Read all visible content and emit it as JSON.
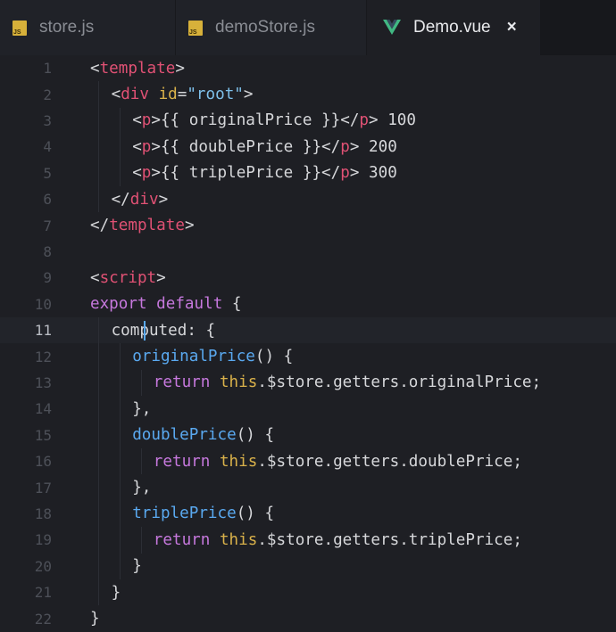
{
  "tabs": [
    {
      "label": "store.js",
      "icon": "js-file-icon",
      "active": false
    },
    {
      "label": "demoStore.js",
      "icon": "js-file-icon",
      "active": false
    },
    {
      "label": "Demo.vue",
      "icon": "vue-file-icon",
      "active": true,
      "close": "×"
    }
  ],
  "js_icon_text": "JS",
  "active_line": 11,
  "colors": {
    "tag": "#e05174",
    "attribute": "#d9b14a",
    "string": "#7ec0ea",
    "keyword": "#c678dd",
    "function": "#5aa9f0",
    "vue_green": "#41b883"
  },
  "lines": [
    {
      "n": "1",
      "indent": 0,
      "tokens": [
        [
          "plain",
          "<"
        ],
        [
          "tag",
          "template"
        ],
        [
          "plain",
          ">"
        ]
      ]
    },
    {
      "n": "2",
      "indent": 1,
      "tokens": [
        [
          "plain",
          "<"
        ],
        [
          "tag",
          "div"
        ],
        [
          "plain",
          " "
        ],
        [
          "attr",
          "id"
        ],
        [
          "plain",
          "="
        ],
        [
          "str",
          "\"root\""
        ],
        [
          "plain",
          ">"
        ]
      ]
    },
    {
      "n": "3",
      "indent": 2,
      "tokens": [
        [
          "plain",
          "<"
        ],
        [
          "tag",
          "p"
        ],
        [
          "plain",
          ">{{ originalPrice }}</"
        ],
        [
          "tag",
          "p"
        ],
        [
          "plain",
          "> 100"
        ]
      ]
    },
    {
      "n": "4",
      "indent": 2,
      "tokens": [
        [
          "plain",
          "<"
        ],
        [
          "tag",
          "p"
        ],
        [
          "plain",
          ">{{ doublePrice }}</"
        ],
        [
          "tag",
          "p"
        ],
        [
          "plain",
          "> 200"
        ]
      ]
    },
    {
      "n": "5",
      "indent": 2,
      "tokens": [
        [
          "plain",
          "<"
        ],
        [
          "tag",
          "p"
        ],
        [
          "plain",
          ">{{ triplePrice }}</"
        ],
        [
          "tag",
          "p"
        ],
        [
          "plain",
          "> 300"
        ]
      ]
    },
    {
      "n": "6",
      "indent": 1,
      "tokens": [
        [
          "plain",
          "</"
        ],
        [
          "tag",
          "div"
        ],
        [
          "plain",
          ">"
        ]
      ]
    },
    {
      "n": "7",
      "indent": 0,
      "tokens": [
        [
          "plain",
          "</"
        ],
        [
          "tag",
          "template"
        ],
        [
          "plain",
          ">"
        ]
      ]
    },
    {
      "n": "8",
      "indent": 0,
      "tokens": []
    },
    {
      "n": "9",
      "indent": 0,
      "tokens": [
        [
          "plain",
          "<"
        ],
        [
          "tag",
          "script"
        ],
        [
          "plain",
          ">"
        ]
      ]
    },
    {
      "n": "10",
      "indent": 0,
      "tokens": [
        [
          "kw",
          "export"
        ],
        [
          "plain",
          " "
        ],
        [
          "kw",
          "default"
        ],
        [
          "plain",
          " {"
        ]
      ]
    },
    {
      "n": "11",
      "indent": 1,
      "tokens": [
        [
          "plain",
          "computed: {"
        ]
      ]
    },
    {
      "n": "12",
      "indent": 2,
      "tokens": [
        [
          "fn",
          "originalPrice"
        ],
        [
          "plain",
          "() {"
        ]
      ]
    },
    {
      "n": "13",
      "indent": 3,
      "tokens": [
        [
          "kw",
          "return"
        ],
        [
          "plain",
          " "
        ],
        [
          "this",
          "this"
        ],
        [
          "plain",
          ".$store.getters.originalPrice;"
        ]
      ]
    },
    {
      "n": "14",
      "indent": 2,
      "tokens": [
        [
          "plain",
          "},"
        ]
      ]
    },
    {
      "n": "15",
      "indent": 2,
      "tokens": [
        [
          "fn",
          "doublePrice"
        ],
        [
          "plain",
          "() {"
        ]
      ]
    },
    {
      "n": "16",
      "indent": 3,
      "tokens": [
        [
          "kw",
          "return"
        ],
        [
          "plain",
          " "
        ],
        [
          "this",
          "this"
        ],
        [
          "plain",
          ".$store.getters.doublePrice;"
        ]
      ]
    },
    {
      "n": "17",
      "indent": 2,
      "tokens": [
        [
          "plain",
          "},"
        ]
      ]
    },
    {
      "n": "18",
      "indent": 2,
      "tokens": [
        [
          "fn",
          "triplePrice"
        ],
        [
          "plain",
          "() {"
        ]
      ]
    },
    {
      "n": "19",
      "indent": 3,
      "tokens": [
        [
          "kw",
          "return"
        ],
        [
          "plain",
          " "
        ],
        [
          "this",
          "this"
        ],
        [
          "plain",
          ".$store.getters.triplePrice;"
        ]
      ]
    },
    {
      "n": "20",
      "indent": 2,
      "tokens": [
        [
          "plain",
          "}"
        ]
      ]
    },
    {
      "n": "21",
      "indent": 1,
      "tokens": [
        [
          "plain",
          "}"
        ]
      ]
    },
    {
      "n": "22",
      "indent": 0,
      "tokens": [
        [
          "plain",
          "}"
        ]
      ]
    }
  ]
}
